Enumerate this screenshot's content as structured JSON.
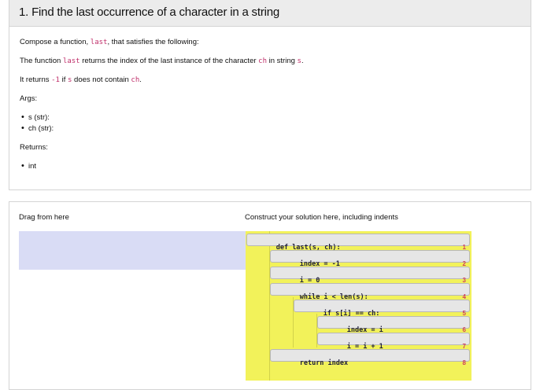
{
  "question": {
    "title": "1. Find the last occurrence of a character in a string",
    "compose_prefix": "Compose a function, ",
    "func_name": "last",
    "compose_suffix": ", that satisfies the following:",
    "desc_prefix": "The function ",
    "desc_mid1": " returns the index of the last instance of the character ",
    "ch": "ch",
    "desc_mid2": " in string ",
    "s": "s",
    "desc_end": ".",
    "returns_prefix": "It returns ",
    "neg_one": "-1",
    "returns_mid": " if ",
    "returns_mid2": " does not contain ",
    "args_heading": "Args:",
    "args": [
      "s (str):",
      "ch (str):"
    ],
    "returns_heading": "Returns:",
    "returns": [
      "int"
    ]
  },
  "parsons": {
    "drag_label": "Drag from here",
    "construct_label": "Construct your solution here, including indents",
    "blocks": [
      {
        "code": "def last(s, ch):",
        "indent": 0,
        "line": "1"
      },
      {
        "code": "index = -1",
        "indent": 1,
        "line": "2"
      },
      {
        "code": "i = 0",
        "indent": 1,
        "line": "3"
      },
      {
        "code": "while i < len(s):",
        "indent": 1,
        "line": "4"
      },
      {
        "code": "if s[i] == ch:",
        "indent": 2,
        "line": "5"
      },
      {
        "code": "index = i",
        "indent": 3,
        "line": "6"
      },
      {
        "code": "i = i + 1",
        "indent": 3,
        "line": "7"
      },
      {
        "code": "return index",
        "indent": 1,
        "line": "8"
      }
    ],
    "colors": {
      "drag_area": "#d9dcf5",
      "solution_area": "#f2f25a",
      "line_number": "#d0405a"
    }
  }
}
